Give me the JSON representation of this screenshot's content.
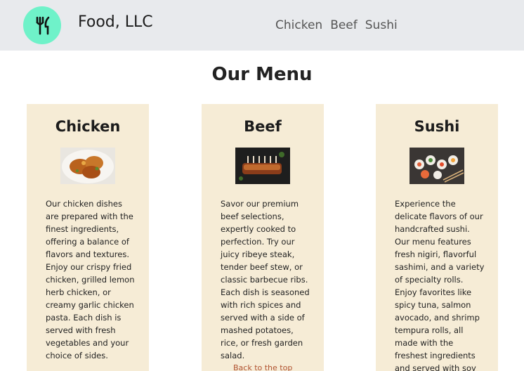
{
  "header": {
    "brand": "Food, LLC",
    "logo_icon": "fork-knife-icon",
    "nav": [
      "Chicken",
      "Beef",
      "Sushi"
    ]
  },
  "main": {
    "title": "Our Menu",
    "cards": [
      {
        "title": "Chicken",
        "image": "fried-chicken-plate-photo",
        "text": "Our chicken dishes are prepared with the finest ingredients, offering a balance of flavors and textures. Enjoy our crispy fried chicken, grilled lemon herb chicken, or creamy garlic chicken pasta. Each dish is served with fresh vegetables and your choice of sides."
      },
      {
        "title": "Beef",
        "image": "beef-ribs-photo",
        "text": "Savor our premium beef selections, expertly cooked to perfection. Try our juicy ribeye steak, tender beef stew, or classic barbecue ribs. Each dish is seasoned with rich spices and served with a side of mashed potatoes, rice, or fresh garden salad.",
        "link": "Back to the top"
      },
      {
        "title": "Sushi",
        "image": "sushi-platter-photo",
        "text": "Experience the delicate flavors of our handcrafted sushi. Our menu features fresh nigiri, flavorful sashimi, and a variety of specialty rolls. Enjoy favorites like spicy tuna, salmon avocado, and shrimp tempura rolls, all made with the freshest ingredients and served with soy sauce and wasabi."
      }
    ]
  },
  "colors": {
    "header_bg": "#e8eaed",
    "logo_bg": "#6ff2c9",
    "card_bg": "#f6ecd6"
  }
}
